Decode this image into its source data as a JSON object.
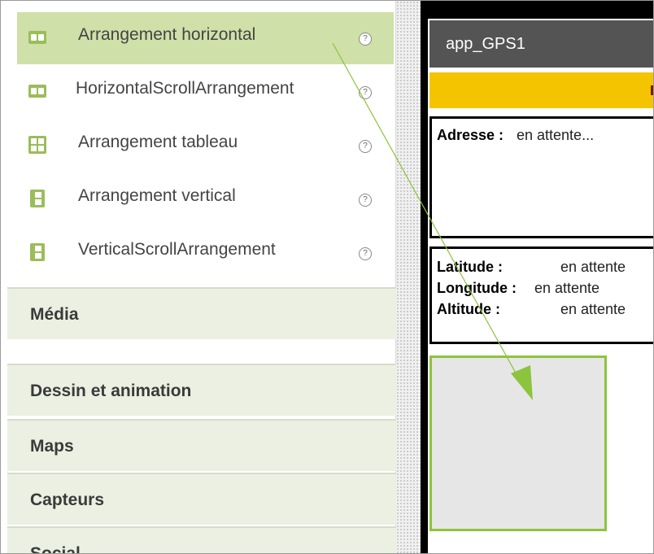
{
  "palette": {
    "components": [
      {
        "label": "Arrangement horizontal",
        "icon": "horizontal-arrangement-icon",
        "selected": true
      },
      {
        "label": "HorizontalScrollArrangement",
        "icon": "horizontal-scroll-arrangement-icon",
        "selected": false
      },
      {
        "label": "Arrangement tableau",
        "icon": "table-arrangement-icon",
        "selected": false
      },
      {
        "label": "Arrangement vertical",
        "icon": "vertical-arrangement-icon",
        "selected": false
      },
      {
        "label": "VerticalScrollArrangement",
        "icon": "vertical-scroll-arrangement-icon",
        "selected": false
      }
    ],
    "help_glyph": "?",
    "categories": [
      {
        "label": "Média"
      },
      {
        "label": "Dessin et animation"
      },
      {
        "label": "Maps"
      },
      {
        "label": "Capteurs"
      },
      {
        "label": "Social"
      }
    ]
  },
  "preview": {
    "title": "app_GPS1",
    "adresse_label": "Adresse :",
    "adresse_value": "en attente...",
    "latitude_label": "Latitude :",
    "latitude_value": "en attente",
    "longitude_label": "Longitude :",
    "longitude_value": "en attente",
    "altitude_label": "Altitude :",
    "altitude_value": "en attente"
  },
  "colors": {
    "selected_bg": "#cfe0a8",
    "category_bg": "#ecf0e2",
    "title_bar": "#545454",
    "yellow_bar": "#f5c400",
    "arrangement_border": "#8cc43d",
    "arrow": "#8cc43d"
  }
}
